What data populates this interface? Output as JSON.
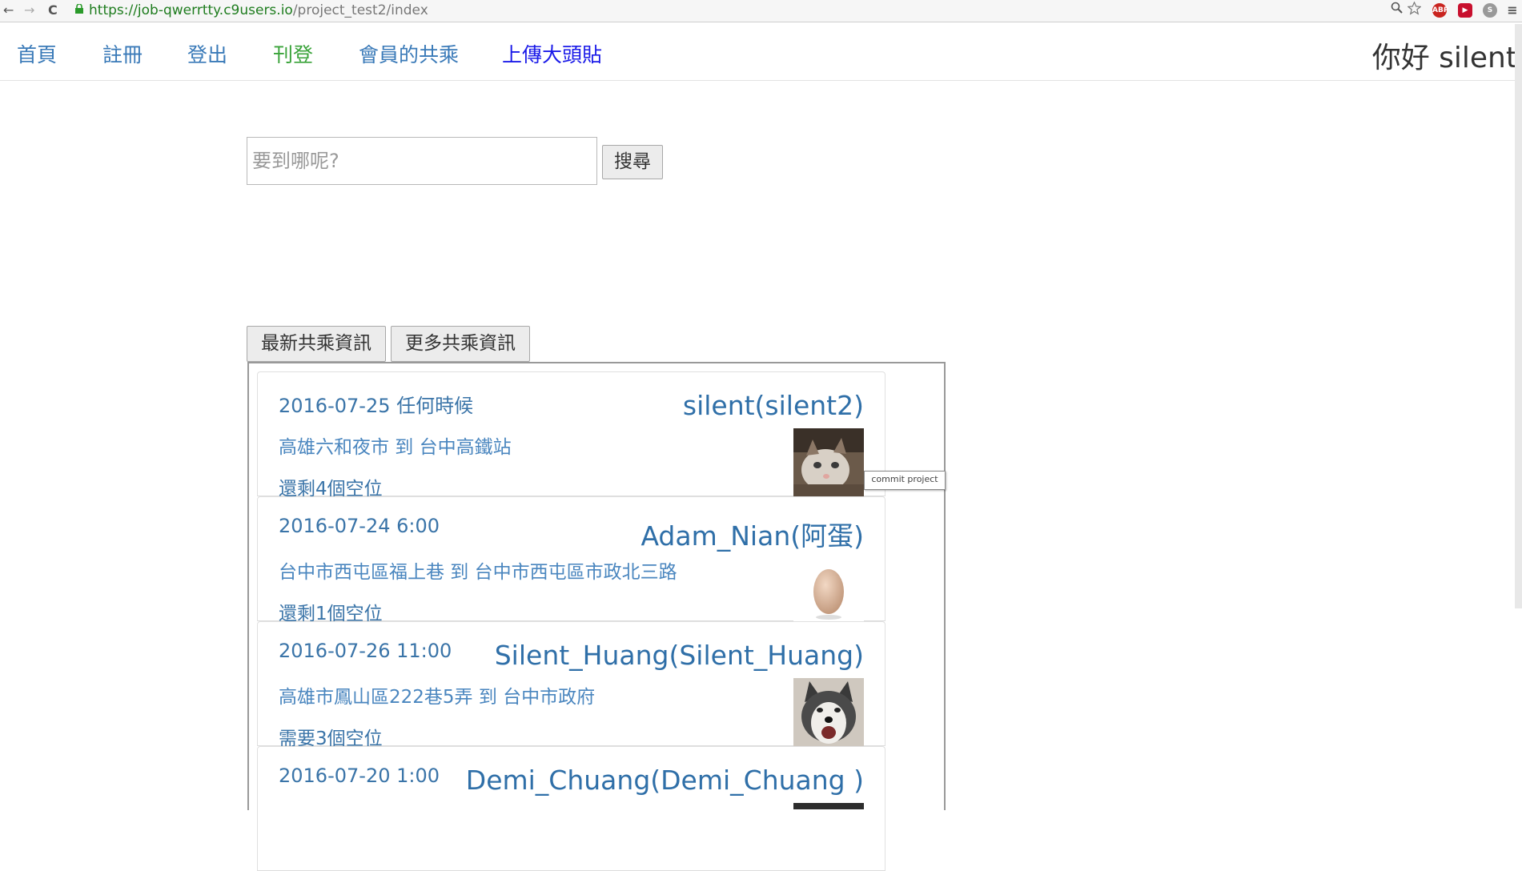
{
  "browser": {
    "url_host": "https://job-qwerrtty.c9users.io",
    "url_path": "/project_test2/index",
    "back_glyph": "←",
    "forward_glyph": "→",
    "reload_glyph": "C",
    "ext_abp": "ABP"
  },
  "nav": {
    "items": [
      {
        "label": "首頁",
        "color": "#3a7ab8"
      },
      {
        "label": "註冊",
        "color": "#3a7ab8"
      },
      {
        "label": "登出",
        "color": "#3a7ab8"
      },
      {
        "label": "刊登",
        "color": "#3aa33a"
      },
      {
        "label": "會員的共乘",
        "color": "#3a7ab8"
      },
      {
        "label": "上傳大頭貼",
        "color": "#1a1ae8"
      }
    ],
    "greeting": "你好 silent"
  },
  "search": {
    "placeholder": "要到哪呢?",
    "button_label": "搜尋"
  },
  "tabs": {
    "latest": "最新共乘資訊",
    "more": "更多共乘資訊"
  },
  "tooltip": "commit project",
  "rides": [
    {
      "datetime": "2016-07-25 任何時候",
      "route": "高雄六和夜市 到 台中高鐵站",
      "seats": "還剩4個空位",
      "user": "silent(silent2)",
      "avatar": "kitten-icon"
    },
    {
      "datetime": "2016-07-24 6:00",
      "route": "台中市西屯區福上巷 到 台中市西屯區市政北三路",
      "seats": "還剩1個空位",
      "user": "Adam_Nian(阿蛋)",
      "avatar": "egg-icon"
    },
    {
      "datetime": "2016-07-26 11:00",
      "route": "高雄市鳳山區222巷5弄 到 台中市政府",
      "seats": "需要3個空位",
      "user": "Silent_Huang(Silent_Huang)",
      "avatar": "husky-icon"
    },
    {
      "datetime": "2016-07-20 1:00",
      "route": "",
      "seats": "",
      "user": "Demi_Chuang(Demi_Chuang )",
      "avatar": "dark-photo-icon"
    }
  ]
}
